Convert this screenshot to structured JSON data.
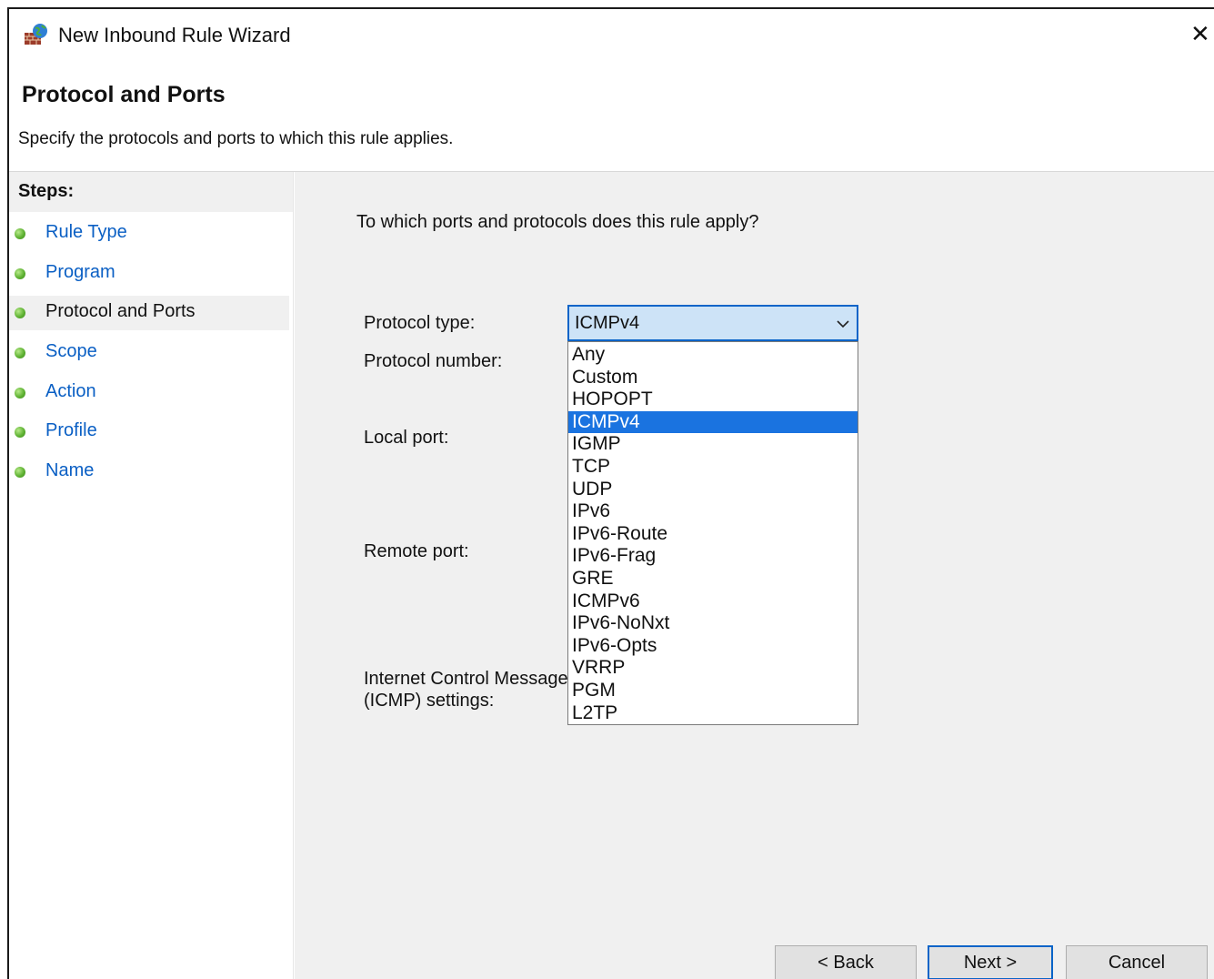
{
  "window": {
    "title": "New Inbound Rule Wizard",
    "close_glyph": "✕"
  },
  "header": {
    "title": "Protocol and Ports",
    "subtitle": "Specify the protocols and ports to which this rule applies."
  },
  "steps": {
    "title": "Steps:",
    "items": [
      {
        "label": "Rule Type"
      },
      {
        "label": "Program"
      },
      {
        "label": "Protocol and Ports",
        "current": true
      },
      {
        "label": "Scope"
      },
      {
        "label": "Action"
      },
      {
        "label": "Profile"
      },
      {
        "label": "Name"
      }
    ]
  },
  "main": {
    "question": "To which ports and protocols does this rule apply?",
    "protocol_type_label": "Protocol type:",
    "protocol_number_label": "Protocol number:",
    "local_port_label": "Local port:",
    "remote_port_label": "Remote port:",
    "icmp_label_line1": "Internet Control Message",
    "icmp_label_line2": "(ICMP) settings:",
    "protocol_type_value": "ICMPv4",
    "protocol_options": [
      "Any",
      "Custom",
      "HOPOPT",
      "ICMPv4",
      "IGMP",
      "TCP",
      "UDP",
      "IPv6",
      "IPv6-Route",
      "IPv6-Frag",
      "GRE",
      "ICMPv6",
      "IPv6-NoNxt",
      "IPv6-Opts",
      "VRRP",
      "PGM",
      "L2TP"
    ],
    "protocol_selected": "ICMPv4"
  },
  "buttons": {
    "back": "< Back",
    "next": "Next >",
    "cancel": "Cancel"
  },
  "colors": {
    "link": "#0a5fc4",
    "selection": "#1a73e0",
    "combo_focus_border": "#0a64c8"
  },
  "icons": {
    "app": "firewall-icon",
    "close": "close-icon",
    "dropdown": "chevron-down-icon",
    "step_bullet": "green-dot-icon"
  }
}
